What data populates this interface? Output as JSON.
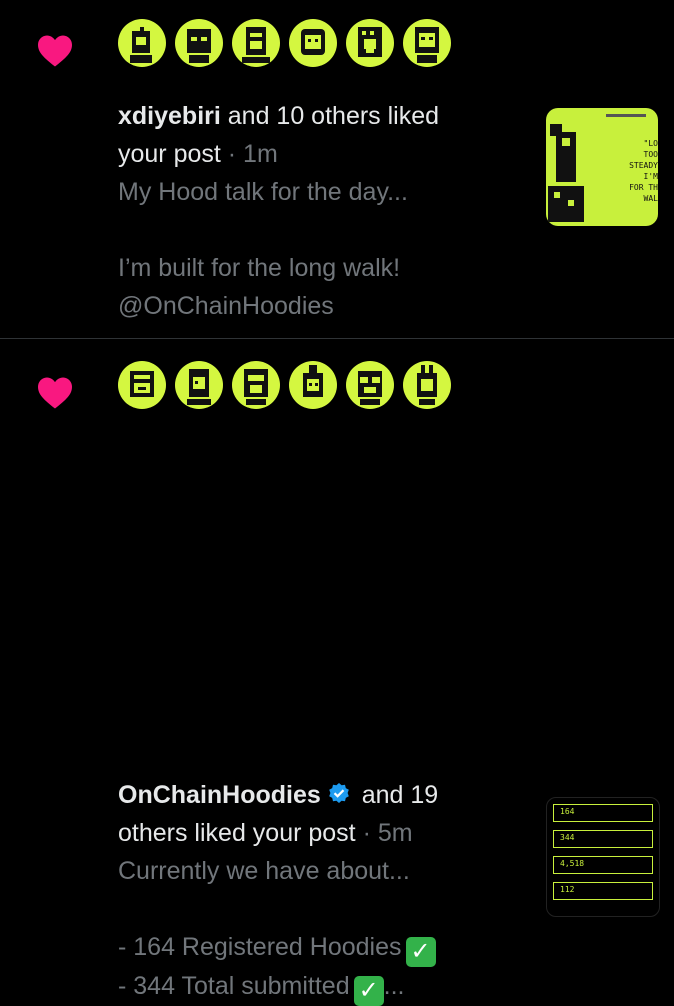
{
  "notifications": [
    {
      "actor": "xdiyebiri",
      "action_line1": " and 10 others liked",
      "action_line2": "your post",
      "time": " · 1m",
      "preview_lines": [
        "My Hood talk for the day...",
        "",
        "I’m built for the long walk!",
        "@OnChainHoodies"
      ],
      "thumb_quote_lines": [
        "\"LO",
        "TOO",
        "STEADY",
        "I'M",
        "FOR TH",
        "WAL"
      ]
    },
    {
      "actor": "OnChainHoodies",
      "verified": true,
      "action_line1": " and 19",
      "action_line2": "others liked your post",
      "time": " · 5m",
      "preview_lines": [
        "Currently we have about...",
        "",
        "- 164 Registered Hoodies",
        "- 344 Total submitted",
        "..."
      ],
      "thumb_stats": [
        "164",
        "344",
        "4,518",
        "112"
      ]
    }
  ],
  "colors": {
    "heart": "#f91880",
    "avatar_bg": "#d4f740",
    "verified": "#1d9bf0",
    "checkmark_box": "#33b24a"
  },
  "icons": {
    "like": "heart-icon",
    "verified": "verified-badge-icon",
    "check": "check-mark-button-emoji"
  }
}
